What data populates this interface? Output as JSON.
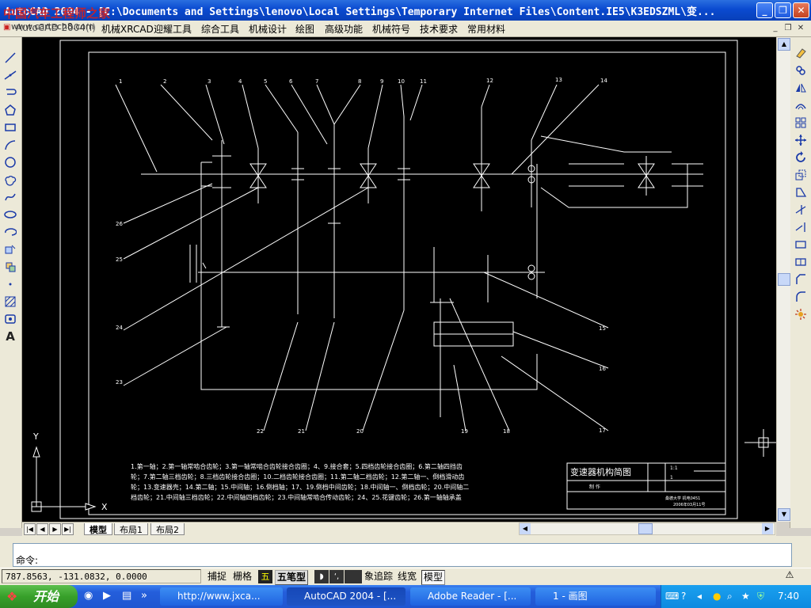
{
  "window": {
    "title_prefix": "AutoCAD 2004 - ",
    "title_path": "[C:\\Documents and Settings\\lenovo\\Local Settings\\Temporary Internet Files\\Content.IE5\\K3EDSZML\\变...",
    "watermark": "中国汽车工程师之家",
    "watermark_url": "www.cartech8.com",
    "buttons": [
      "_",
      "❐",
      "✕"
    ]
  },
  "menubar": {
    "items": [
      "AutoCAD 2004(I)",
      "机械XRCAD",
      "迎耀工具",
      "综合工具",
      "机械设计",
      "绘图",
      "高级功能",
      "机械符号",
      "技术要求",
      "常用材料"
    ],
    "mdi_buttons": [
      "_",
      "❐",
      "✕"
    ]
  },
  "drawing": {
    "part_numbers_top": [
      "1",
      "2",
      "3",
      "4",
      "5",
      "6",
      "7",
      "8",
      "9",
      "10",
      "11",
      "12",
      "13",
      "14"
    ],
    "part_numbers_left": [
      "26",
      "25",
      "24",
      "23"
    ],
    "part_numbers_right": [
      "15",
      "16",
      "17"
    ],
    "part_numbers_bottom": [
      "22",
      "21",
      "20",
      "19",
      "18"
    ],
    "legend_lines": [
      "1.第一轴；2.第一轴常啮合齿轮；3.第一轴常啮合齿轮接合齿圈；4、9.接合套；5.四档齿轮接合齿圈；6.第二轴四挡齿",
      "轮；7.第二轴三档齿轮；8.三档齿轮接合齿圈；10.二档齿轮接合齿圈；11.第二轴二档齿轮；12.第二轴一、倒档滑动齿",
      "轮；13.变速器壳；14.第二轴；15.中间轴；16.倒档轴；17、19.倒档中间齿轮；18.中间轴一、倒档齿轮；20.中间轴二",
      "档齿轮；21.中间轴三档齿轮；22.中间轴四档齿轮；23.中间轴常啮合传动齿轮；24、25.花键齿轮；26.第一轴轴承盖"
    ],
    "title_block": {
      "title": "变速器机构简图",
      "scale": "1:1",
      "qty": "1",
      "drawn": "制 作",
      "school": "桑德大学 机电0451",
      "code": "2006年03月11号"
    },
    "ucs_label_y": "Y",
    "ucs_label_x": "X"
  },
  "layout_tabs": [
    "模型",
    "布局1",
    "布局2"
  ],
  "command": {
    "prompt": "命令:",
    "value": ""
  },
  "status": {
    "coordinates": "787.8563, -131.0832, 0.0000",
    "toggles": [
      "捕捉",
      "栅格",
      "五笔型",
      "象追踪",
      "线宽",
      "模型"
    ]
  },
  "taskbar": {
    "start": "开始",
    "tasks": [
      "http://www.jxca...",
      "AutoCAD 2004 - [...",
      "Adobe Reader - [...",
      "1 - 画图"
    ],
    "clock": "7:40"
  },
  "colors": {
    "canvas": "#000000",
    "drawing_lines": "#ffffff",
    "titlebar": "#0a4ad0",
    "taskbar": "#245edb"
  }
}
